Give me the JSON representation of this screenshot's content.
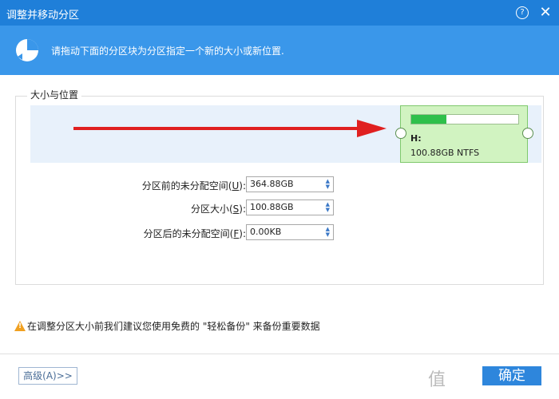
{
  "window": {
    "title": "调整并移动分区",
    "help_icon": "question-icon",
    "close_icon": "close-icon"
  },
  "banner": {
    "text": "请拖动下面的分区块为分区指定一个新的大小或新位置."
  },
  "group": {
    "label": "大小与位置"
  },
  "partition": {
    "letter": "H:",
    "size_label": "100.88GB NTFS",
    "usage_fraction": 0.33
  },
  "fields": [
    {
      "label": "分区前的未分配空间(",
      "hotkey": "U",
      "suffix": "):",
      "value": "364.88GB"
    },
    {
      "label": "分区大小(",
      "hotkey": "S",
      "suffix": "):",
      "value": "100.88GB"
    },
    {
      "label": "分区后的未分配空间(",
      "hotkey": "F",
      "suffix": "):",
      "value": "0.00KB"
    }
  ],
  "warning": {
    "text": "在调整分区大小前我们建议您使用免费的 \"轻松备份\" 来备份重要数据"
  },
  "buttons": {
    "advanced": "高级(A)>>",
    "ok": "确定"
  },
  "colors": {
    "titlebar": "#1f7fd9",
    "banner": "#3a97ea",
    "partition_fill": "#d1f3c1",
    "usage_bar": "#2fc04b",
    "arrow": "#e02020"
  }
}
